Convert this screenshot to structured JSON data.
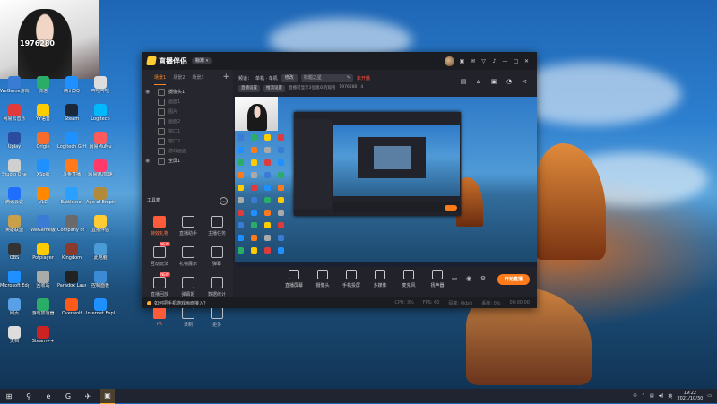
{
  "colors": {
    "accent": "#ff7a1a",
    "window_bg": "#22232a",
    "sidebar_bg": "#26272e",
    "taskbar_bg": "#1f2430"
  },
  "webcam": {
    "label": "1976280"
  },
  "desktop_icons": [
    {
      "label": "WeGame游戏",
      "color": "#3a7bd5"
    },
    {
      "label": "微信",
      "color": "#2aae67"
    },
    {
      "label": "腾讯QQ",
      "color": "#1e90ff"
    },
    {
      "label": "哔哩哔哩",
      "color": "#dddddd"
    },
    {
      "label": "网易云音乐",
      "color": "#e03a3a"
    },
    {
      "label": "YY语音",
      "color": "#ffcc00"
    },
    {
      "label": "Steam",
      "color": "#1b2838"
    },
    {
      "label": "Logitech",
      "color": "#00b8fc"
    },
    {
      "label": "Uplay",
      "color": "#2a4da0"
    },
    {
      "label": "Origin",
      "color": "#f56c2d"
    },
    {
      "label": "Logitech G HUB",
      "color": "#1e90ff"
    },
    {
      "label": "网易MuMu",
      "color": "#ff5a5a"
    },
    {
      "label": "Studio One",
      "color": "#d0d0d0"
    },
    {
      "label": "XSplit",
      "color": "#1e90ff"
    },
    {
      "label": "斗鱼直播",
      "color": "#ff7a1a"
    },
    {
      "label": "网易UU加速",
      "color": "#ff3a6a"
    },
    {
      "label": "腾讯会议",
      "color": "#1e6fff"
    },
    {
      "label": "VLC",
      "color": "#ff8800"
    },
    {
      "label": "Battle.net",
      "color": "#2aa0ff"
    },
    {
      "label": "Age of Empires IV",
      "color": "#b28a3a"
    },
    {
      "label": "英雄联盟",
      "color": "#c8a04a"
    },
    {
      "label": "WeGame版",
      "color": "#3a7bd5"
    },
    {
      "label": "Company of Heroes 2",
      "color": "#6a6a6a"
    },
    {
      "label": "直播伴侣",
      "color": "#ffcc33"
    },
    {
      "label": "OBS",
      "color": "#333333"
    },
    {
      "label": "Potplayer",
      "color": "#ffcc00"
    },
    {
      "label": "Kingdom",
      "color": "#8a3a2a"
    },
    {
      "label": "此电脑",
      "color": "#4a9ad6"
    },
    {
      "label": "Microsoft Edge",
      "color": "#1e90ff"
    },
    {
      "label": "回收站",
      "color": "#aaaaaa"
    },
    {
      "label": "Paradox Launcher",
      "color": "#222222"
    },
    {
      "label": "控制面板",
      "color": "#3a8ad6"
    },
    {
      "label": "网页",
      "color": "#5aa0e6"
    },
    {
      "label": "游戏加速器",
      "color": "#2aae67"
    },
    {
      "label": "Overwolf",
      "color": "#ff5a1a"
    },
    {
      "label": "Internet Explorer",
      "color": "#1e90ff"
    },
    {
      "label": "文档",
      "color": "#dddddd"
    },
    {
      "label": "Steam++",
      "color": "#cc2222"
    }
  ],
  "app": {
    "brand": "直播伴侣",
    "version": "标准 ▾",
    "titlebar_icons": [
      "gift-icon",
      "message-icon",
      "shirt-icon",
      "bell-icon",
      "minimize-icon",
      "maximize-icon",
      "close-icon"
    ],
    "sidebar": {
      "tabs": [
        "场景1",
        "场景2",
        "场景3"
      ],
      "active_tab": 0,
      "add": "+",
      "sources": [
        {
          "label": "摄像头1",
          "visible": true
        },
        {
          "label": "画面1",
          "visible": false
        },
        {
          "label": "图片",
          "visible": false
        },
        {
          "label": "画面2",
          "visible": false
        },
        {
          "label": "窗口1",
          "visible": false
        },
        {
          "label": "窗口2",
          "visible": false
        },
        {
          "label": "游戏画面",
          "visible": false
        },
        {
          "label": "全屏1",
          "visible": true
        }
      ],
      "tools_title": "工具箱",
      "tools_more": "...",
      "tools": [
        {
          "label": "特效礼物",
          "hot": true,
          "badge": ""
        },
        {
          "label": "直播助手",
          "hot": false,
          "badge": ""
        },
        {
          "label": "主播任务",
          "hot": false,
          "badge": ""
        },
        {
          "label": "互动玩法",
          "hot": false,
          "badge": "NEW"
        },
        {
          "label": "礼物展示",
          "hot": false,
          "badge": ""
        },
        {
          "label": "弹幕",
          "hot": false,
          "badge": ""
        },
        {
          "label": "直播回放",
          "hot": false,
          "badge": "NEW"
        },
        {
          "label": "弹幕姬",
          "hot": false,
          "badge": ""
        },
        {
          "label": "数据统计",
          "hot": false,
          "badge": ""
        },
        {
          "label": "PK",
          "hot": true,
          "badge": "NEW"
        },
        {
          "label": "录制",
          "hot": false,
          "badge": ""
        },
        {
          "label": "更多",
          "hot": false,
          "badge": ""
        }
      ]
    },
    "main": {
      "category_label": "频道：",
      "category_value": "单机 · 单机",
      "category_btn": "修改",
      "title_placeholder": "标题之星",
      "red_tag": "未开播",
      "info_btn1": "直播设置",
      "info_btn2": "推流设置",
      "info_text": "直播可显示3位观众的观看",
      "room_id": "1976280",
      "fans": "4",
      "icons": [
        "save-icon",
        "lock-icon",
        "gift-box-icon",
        "bell-icon",
        "share-icon"
      ]
    },
    "controls": [
      {
        "label": "直播屏幕"
      },
      {
        "label": "摄像头"
      },
      {
        "label": "手机投屏"
      },
      {
        "label": "多媒体"
      },
      {
        "label": "麦克风"
      },
      {
        "label": "扬声器"
      }
    ],
    "start_button": "开始直播",
    "status": {
      "hint": "如何把手机游戏画面接入？",
      "cpu": "CPU: 3%",
      "fps": "FPS: 60",
      "bitrate": "码率: 0kb/s",
      "drop": "丢帧: 0%",
      "time": "00:00:00"
    }
  },
  "taskbar": {
    "items": [
      "windows-start-icon",
      "search-icon",
      "edge-icon",
      "steam-icon",
      "wegame-icon",
      "live-companion-icon"
    ],
    "tray_text": "英",
    "time": "19:22",
    "date": "2021/10/30"
  }
}
